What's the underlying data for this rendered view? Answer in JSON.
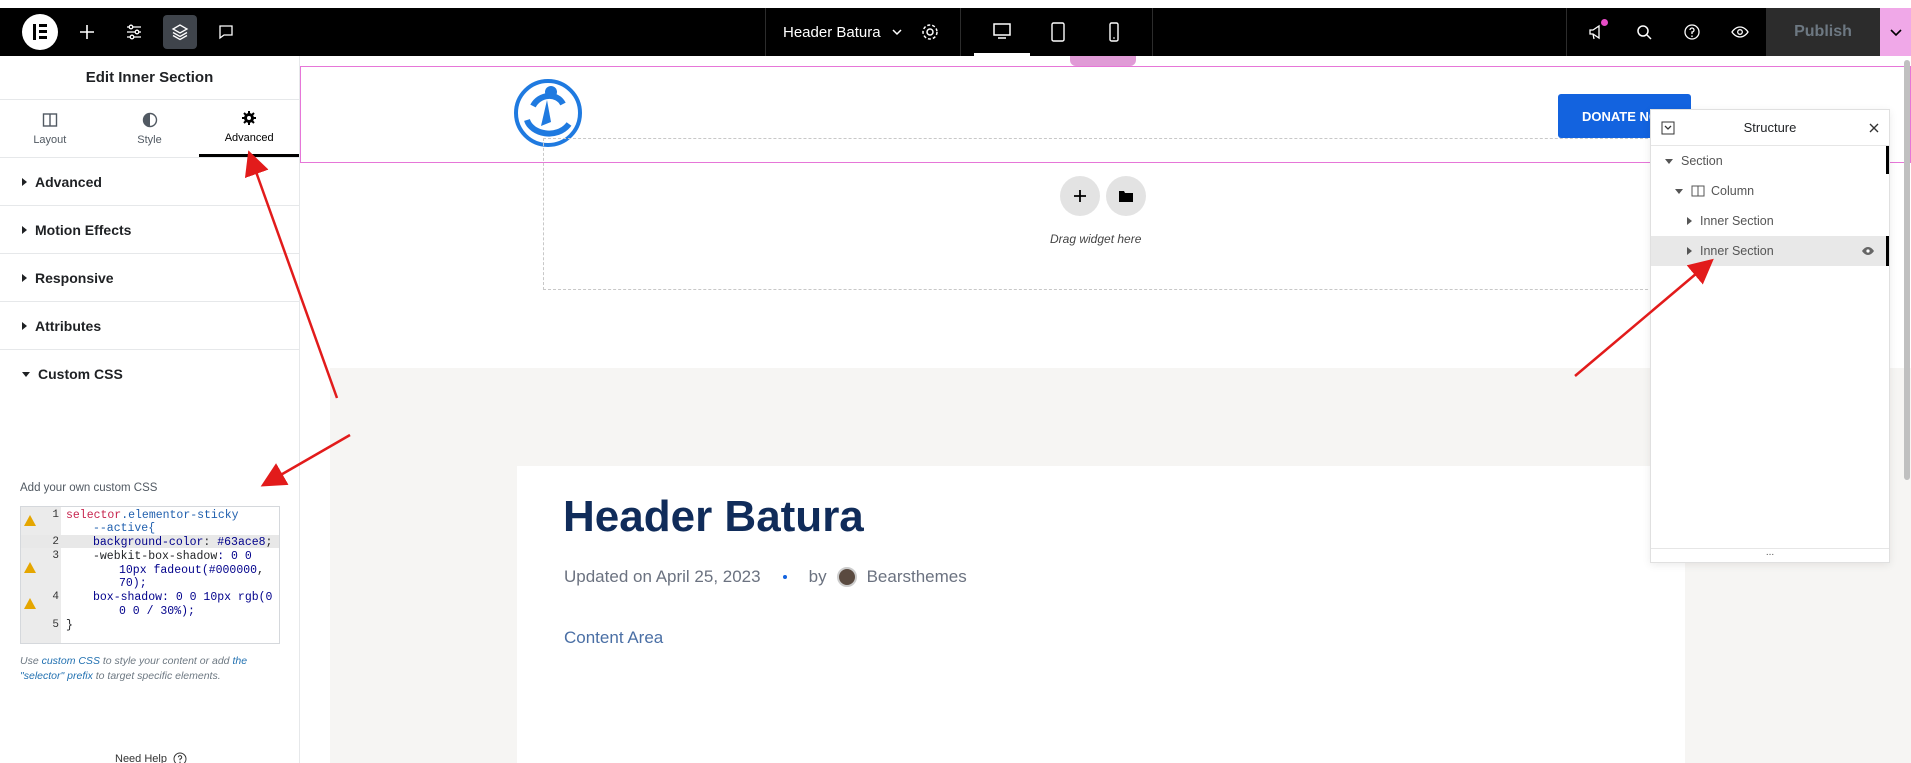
{
  "topbar": {
    "document_title": "Header Batura",
    "publish_label": "Publish"
  },
  "panel": {
    "title": "Edit Inner Section",
    "tabs": [
      {
        "label": "Layout"
      },
      {
        "label": "Style"
      },
      {
        "label": "Advanced"
      }
    ],
    "sections": [
      {
        "label": "Advanced"
      },
      {
        "label": "Motion Effects"
      },
      {
        "label": "Responsive"
      },
      {
        "label": "Attributes"
      },
      {
        "label": "Custom CSS"
      }
    ],
    "custom_css_hint": "Add your own custom CSS",
    "code_lines": {
      "l1_a": "selector",
      "l1_b": ".elementor-sticky",
      "l1_c": "--active{",
      "l2_a": "background-color",
      "l2_b": ": ",
      "l2_c": "#63ace8",
      "l2_d": ";",
      "l3_a": "-webkit-box-shadow",
      "l3_b": ": 0 0",
      "l3_c": "10px fadeout(",
      "l3_d": "#000000",
      "l3_e": ",",
      "l3_f": "70);",
      "l4_a": "box-shadow",
      "l4_b": ": 0 0 10px rgb(0",
      "l4_c": "0 0 / 30%);",
      "l5": "}"
    },
    "line_numbers": [
      "1",
      "2",
      "3",
      "4",
      "5"
    ],
    "usage_prefix": "Use ",
    "usage_link1": "custom CSS",
    "usage_mid": " to style your content or add ",
    "usage_link2": "the \"selector\" prefix",
    "usage_suffix": " to target specific elements.",
    "need_help": "Need Help"
  },
  "canvas": {
    "donate_label": "DONATE NO",
    "drag_text": "Drag widget here",
    "post_title": "Header Batura",
    "updated": "Updated on April 25, 2023",
    "by": "by",
    "author": "Bearsthemes",
    "content_area": "Content Area"
  },
  "structure": {
    "title": "Structure",
    "items": [
      {
        "label": "Section"
      },
      {
        "label": "Column"
      },
      {
        "label": "Inner Section"
      },
      {
        "label": "Inner Section"
      }
    ]
  },
  "colors": {
    "accent_pink": "#e84dc7",
    "donate_blue": "#1363df",
    "title_navy": "#102c5a",
    "annotation_red": "#e21b1b"
  }
}
